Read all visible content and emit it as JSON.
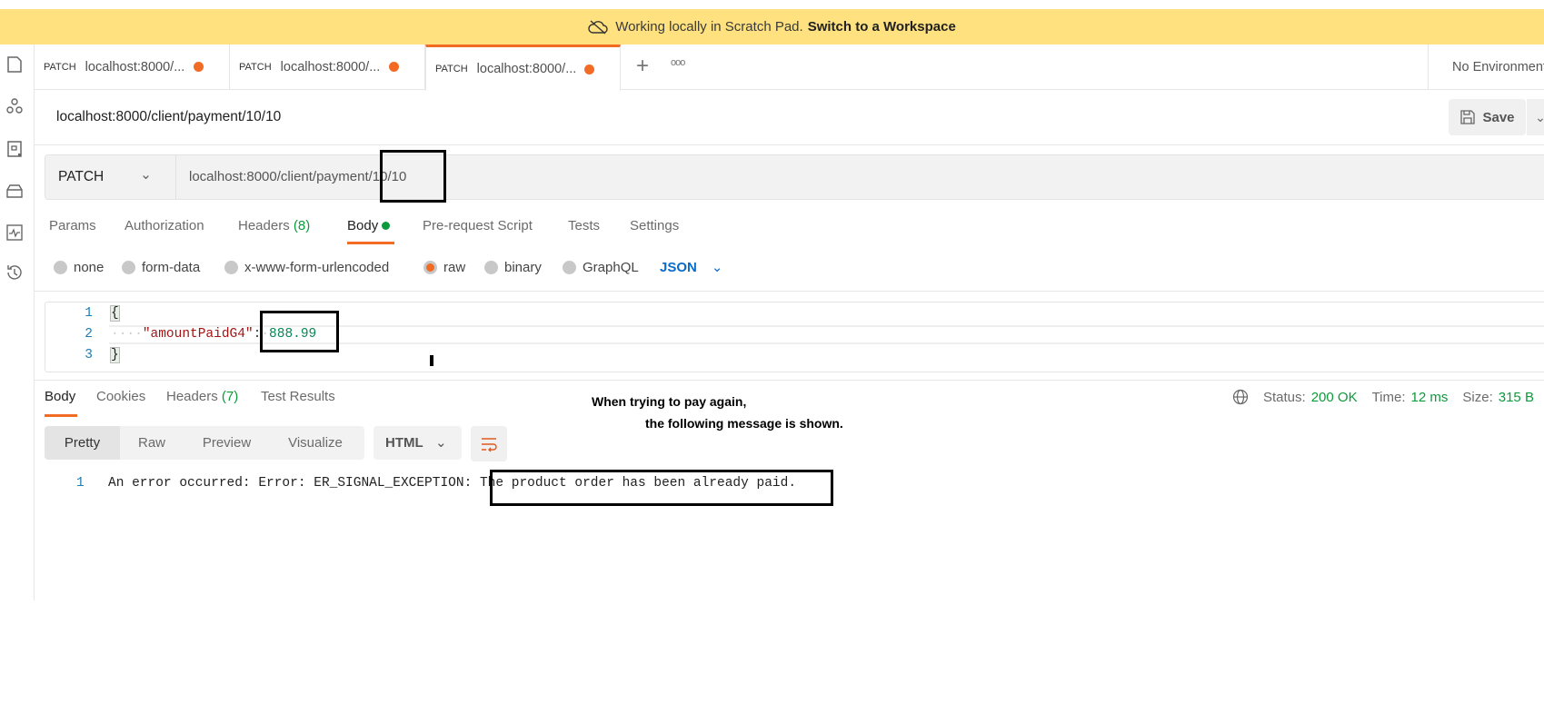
{
  "banner": {
    "text": "Working locally in Scratch Pad.",
    "link": "Switch to a Workspace"
  },
  "tabs": [
    {
      "method": "PATCH",
      "label": "localhost:8000/..."
    },
    {
      "method": "PATCH",
      "label": "localhost:8000/..."
    },
    {
      "method": "PATCH",
      "label": "localhost:8000/..."
    }
  ],
  "environment": "No Environment",
  "request": {
    "title": "localhost:8000/client/payment/10/10",
    "method": "PATCH",
    "url": "localhost:8000/client/payment/10/10",
    "save_label": "Save"
  },
  "request_tabs": {
    "params": "Params",
    "authorization": "Authorization",
    "headers": "Headers",
    "headers_count": "(8)",
    "body": "Body",
    "prerequest": "Pre-request Script",
    "tests": "Tests",
    "settings": "Settings"
  },
  "body_types": {
    "none": "none",
    "form_data": "form-data",
    "urlencoded": "x-www-form-urlencoded",
    "raw": "raw",
    "binary": "binary",
    "graphql": "GraphQL",
    "format": "JSON"
  },
  "editor": {
    "lines": [
      "1",
      "2",
      "3"
    ],
    "open": "{",
    "key": "\"amountPaidG4\"",
    "colon": ":",
    "value": "888.99",
    "close": "}"
  },
  "response_tabs": {
    "body": "Body",
    "cookies": "Cookies",
    "headers": "Headers",
    "headers_count": "(7)",
    "tests": "Test Results"
  },
  "response_meta": {
    "status_label": "Status:",
    "status": "200 OK",
    "time_label": "Time:",
    "time": "12 ms",
    "size_label": "Size:",
    "size": "315 B"
  },
  "view_modes": {
    "pretty": "Pretty",
    "raw": "Raw",
    "preview": "Preview",
    "visualize": "Visualize",
    "format": "HTML"
  },
  "response": {
    "line": "1",
    "prefix": "An error occurred: Error: ER_SIGNAL_EXCEPTION: ",
    "message": "The product order has been already paid."
  },
  "annotation": {
    "line1": "When trying to pay again,",
    "line2": "the following message is shown."
  }
}
